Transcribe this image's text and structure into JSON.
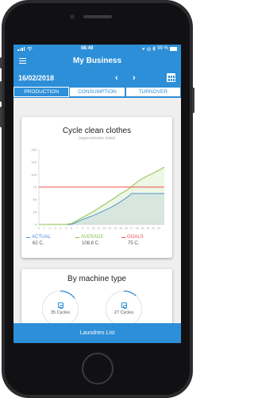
{
  "status_bar": {
    "time": "08:49",
    "battery": "99 %"
  },
  "app_bar": {
    "title": "My Business"
  },
  "date_bar": {
    "date": "16/02/2018",
    "prev": "‹",
    "next": "›"
  },
  "tabs": [
    {
      "label": "PRODUCTION",
      "active": true
    },
    {
      "label": "CONSUMPTION",
      "active": false
    },
    {
      "label": "TURNOVER",
      "active": false
    }
  ],
  "cycle_card": {
    "title": "Cycle clean clothes",
    "subtitle": "(approximate data)",
    "legend": [
      {
        "name": "ACTUAL",
        "value": "62 C.",
        "color": "#4a90e2"
      },
      {
        "name": "AVERAGE",
        "value": "108.8 C.",
        "color": "#8bc34a"
      },
      {
        "name": "GOALS",
        "value": "75 C.",
        "color": "#ef5350"
      }
    ]
  },
  "chart_data": {
    "type": "line",
    "title": "Cycle clean clothes",
    "subtitle": "(approximate data)",
    "xlabel": "",
    "ylabel": "",
    "x": [
      0,
      1,
      2,
      3,
      4,
      5,
      6,
      7,
      8,
      9,
      10,
      11,
      12,
      13,
      14,
      15,
      16,
      17,
      18,
      19,
      20,
      21,
      22,
      23
    ],
    "x_ticks": [
      0,
      1,
      2,
      3,
      4,
      5,
      6,
      7,
      8,
      9,
      10,
      11,
      12,
      13,
      14,
      15,
      16,
      17,
      18,
      19,
      20,
      21,
      22
    ],
    "y_ticks": [
      0,
      25,
      50,
      75,
      100,
      125,
      150
    ],
    "ylim": [
      0,
      150
    ],
    "grid": false,
    "series": [
      {
        "name": "ACTUAL",
        "color": "#4a90e2",
        "fill": true,
        "values": [
          0,
          0,
          0,
          0,
          0,
          0,
          0,
          5,
          10,
          14,
          18,
          23,
          28,
          33,
          39,
          46,
          53,
          62,
          62,
          62,
          62,
          62,
          62,
          62
        ]
      },
      {
        "name": "AVERAGE",
        "color": "#8bc34a",
        "fill": true,
        "values": [
          0,
          0,
          0,
          0,
          0,
          0,
          2,
          8,
          14,
          20,
          26,
          33,
          40,
          47,
          54,
          62,
          68,
          76,
          85,
          92,
          98,
          103,
          108.8,
          115
        ]
      },
      {
        "name": "GOALS",
        "color": "#ef5350",
        "fill": false,
        "values": [
          75,
          75,
          75,
          75,
          75,
          75,
          75,
          75,
          75,
          75,
          75,
          75,
          75,
          75,
          75,
          75,
          75,
          75,
          75,
          75,
          75,
          75,
          75,
          75
        ]
      }
    ]
  },
  "machine_card": {
    "title": "By machine type",
    "gauges": [
      {
        "label": "35 Cycles",
        "progress": 0.15
      },
      {
        "label": "27 Cycles",
        "progress": 0.12
      }
    ]
  },
  "bottom_bar": {
    "label": "Laundries List"
  },
  "colors": {
    "primary": "#2d8fd8",
    "background": "#efefef"
  }
}
